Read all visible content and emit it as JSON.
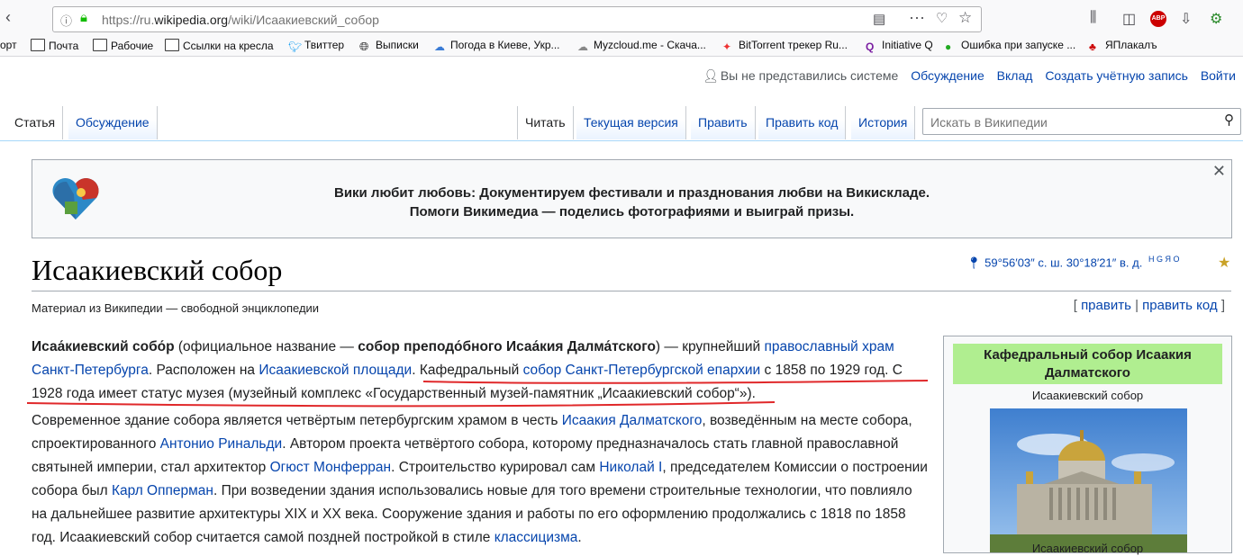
{
  "browser": {
    "url_prefix": "https://ru.",
    "url_domain": "wikipedia.org",
    "url_path": "/wiki/Исаакиевский_собор",
    "bookmarks": [
      {
        "label": "орт"
      },
      {
        "label": "Почта"
      },
      {
        "label": "Рабочие"
      },
      {
        "label": "Ссылки на кресла"
      },
      {
        "label": "Твиттер"
      },
      {
        "label": "Выписки"
      },
      {
        "label": "Погода в Киеве, Укр..."
      },
      {
        "label": "Myzcloud.me - Скача..."
      },
      {
        "label": "BitTorrent трекер Ru..."
      },
      {
        "label": "Initiative Q"
      },
      {
        "label": "Ошибка при запуске ..."
      },
      {
        "label": "ЯПлакалъ"
      }
    ],
    "abp_badge": "ABP"
  },
  "personal": {
    "not_logged": "Вы не представились системе",
    "talk": "Обсуждение",
    "contrib": "Вклад",
    "create": "Создать учётную запись",
    "login": "Войти"
  },
  "tabs": {
    "article": "Статья",
    "talk": "Обсуждение",
    "read": "Читать",
    "current": "Текущая версия",
    "edit": "Править",
    "edit_source": "Править код",
    "history": "История"
  },
  "search": {
    "placeholder": "Искать в Википедии"
  },
  "banner": {
    "line1": "Вики любит любовь: Документируем фестивали и празднования любви на Викискладе.",
    "line2": "Помоги Викимедиа — поделись фотографиями и выиграй призы."
  },
  "article": {
    "title": "Исаакиевский собор",
    "coords": "59°56′03″ с. ш. 30°18′21″ в. д.",
    "coord_links": "H G Я O",
    "tagline": "Материал из Википедии — свободной энциклопедии",
    "edit_open": "[ ",
    "edit": "править",
    "sep": " | ",
    "edit_source": "править код",
    "edit_close": " ]"
  },
  "infobox": {
    "title": "Кафедральный собор Исаакия Далматского",
    "caption": "Исаакиевский собор",
    "image_caption": "Исаакиевский собор"
  }
}
